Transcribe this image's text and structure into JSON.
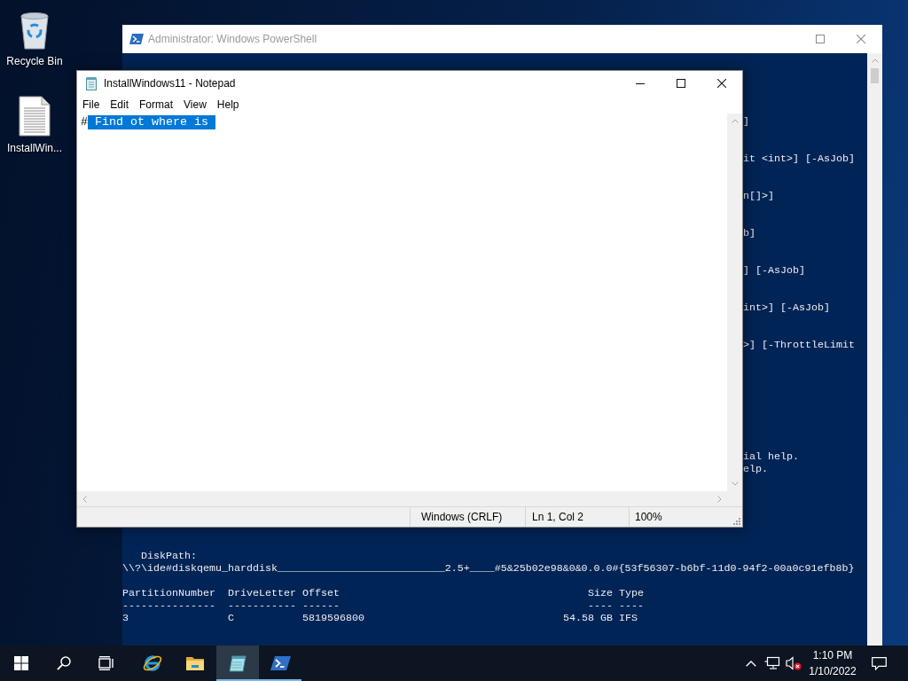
{
  "desktop_icons": [
    {
      "kind": "recycle-bin",
      "label": "Recycle Bin"
    },
    {
      "kind": "text-file",
      "label": "InstallWin..."
    }
  ],
  "powershell_window": {
    "title": "Administrator: Windows PowerShell",
    "active": false,
    "console": {
      "right_fragments": [
        "]",
        "it <int>] [-AsJob]",
        "n[]>]",
        "b]",
        "] [-AsJob]",
        "int>] [-AsJob]",
        ">] [-ThrottleLimit"
      ],
      "help_fragments": [
        "ial help.",
        "elp."
      ],
      "disk_path": {
        "label": "DiskPath:",
        "value": "\\\\?\\ide#diskqemu_harddisk___________________________2.5+____#5&25b02e98&0&0.0.0#{53f56307-b6bf-11d0-94f2-00a0c91efb8b}"
      },
      "partition_table": {
        "columns": [
          {
            "header": "PartitionNumber",
            "rule": "---------------"
          },
          {
            "header": "DriveLetter",
            "rule": "-----------"
          },
          {
            "header": "Offset",
            "rule": "------"
          },
          {
            "header": "Size",
            "rule": "----"
          },
          {
            "header": "Type",
            "rule": "----"
          }
        ],
        "rows": [
          [
            "3",
            "C",
            "5819596800",
            "54.58 GB",
            "IFS"
          ]
        ]
      }
    }
  },
  "notepad_window": {
    "title": "InstallWindows11 - Notepad",
    "active": true,
    "menu": [
      "File",
      "Edit",
      "Format",
      "View",
      "Help"
    ],
    "text": [
      {
        "text": "#",
        "selected": false
      },
      {
        "text": " Find ot where is ",
        "selected": true
      }
    ],
    "status": [
      "Windows (CRLF)",
      "Ln 1, Col 2",
      "100%"
    ]
  },
  "taskbar": {
    "buttons": [
      {
        "kind": "start"
      },
      {
        "kind": "search"
      },
      {
        "kind": "task-view"
      }
    ],
    "apps": [
      {
        "kind": "internet-explorer",
        "open": false,
        "selected": false
      },
      {
        "kind": "file-explorer",
        "open": false,
        "selected": false
      },
      {
        "kind": "notepad",
        "open": true,
        "selected": true
      },
      {
        "kind": "powershell",
        "open": true,
        "selected": false
      }
    ],
    "tray": [
      {
        "kind": "chevron"
      },
      {
        "kind": "network"
      },
      {
        "kind": "volume-muted"
      }
    ],
    "clock": {
      "time": "1:10 PM",
      "date": "1/10/2022"
    }
  }
}
